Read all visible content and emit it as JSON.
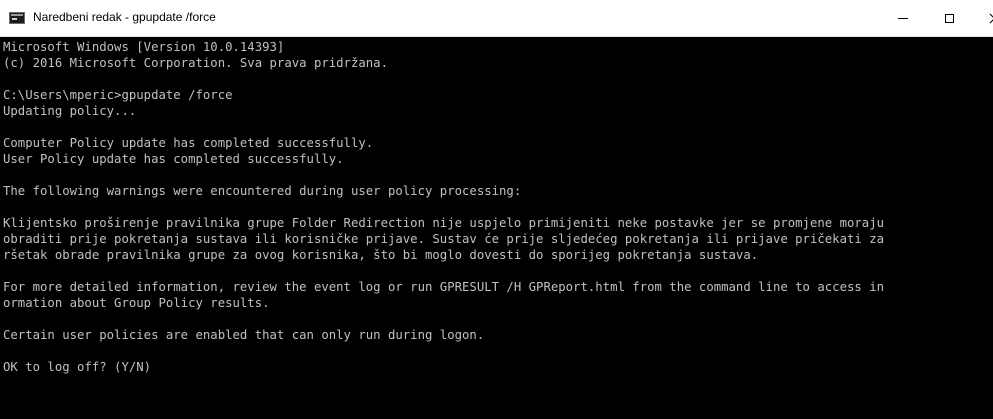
{
  "window": {
    "title": "Naredbeni redak - gpupdate /force",
    "app_icon": "command-prompt-icon",
    "controls": {
      "minimize_icon": "minimize-icon",
      "maximize_icon": "maximize-icon",
      "close_icon": "close-icon"
    }
  },
  "console": {
    "foreground_color": "#c0c0c0",
    "background_color": "#000000",
    "lines": [
      "Microsoft Windows [Version 10.0.14393]",
      "(c) 2016 Microsoft Corporation. Sva prava pridržana.",
      "",
      "C:\\Users\\mperic>gpupdate /force",
      "Updating policy...",
      "",
      "Computer Policy update has completed successfully.",
      "User Policy update has completed successfully.",
      "",
      "The following warnings were encountered during user policy processing:",
      "",
      "Klijentsko proširenje pravilnika grupe Folder Redirection nije uspjelo primijeniti neke postavke jer se promjene moraju",
      "obraditi prije pokretanja sustava ili korisničke prijave. Sustav će prije sljedećeg pokretanja ili prijave pričekati za",
      "ršetak obrade pravilnika grupe za ovog korisnika, što bi moglo dovesti do sporijeg pokretanja sustava.",
      "",
      "For more detailed information, review the event log or run GPRESULT /H GPReport.html from the command line to access in",
      "ormation about Group Policy results.",
      "",
      "Certain user policies are enabled that can only run during logon.",
      "",
      "OK to log off? (Y/N)"
    ]
  }
}
